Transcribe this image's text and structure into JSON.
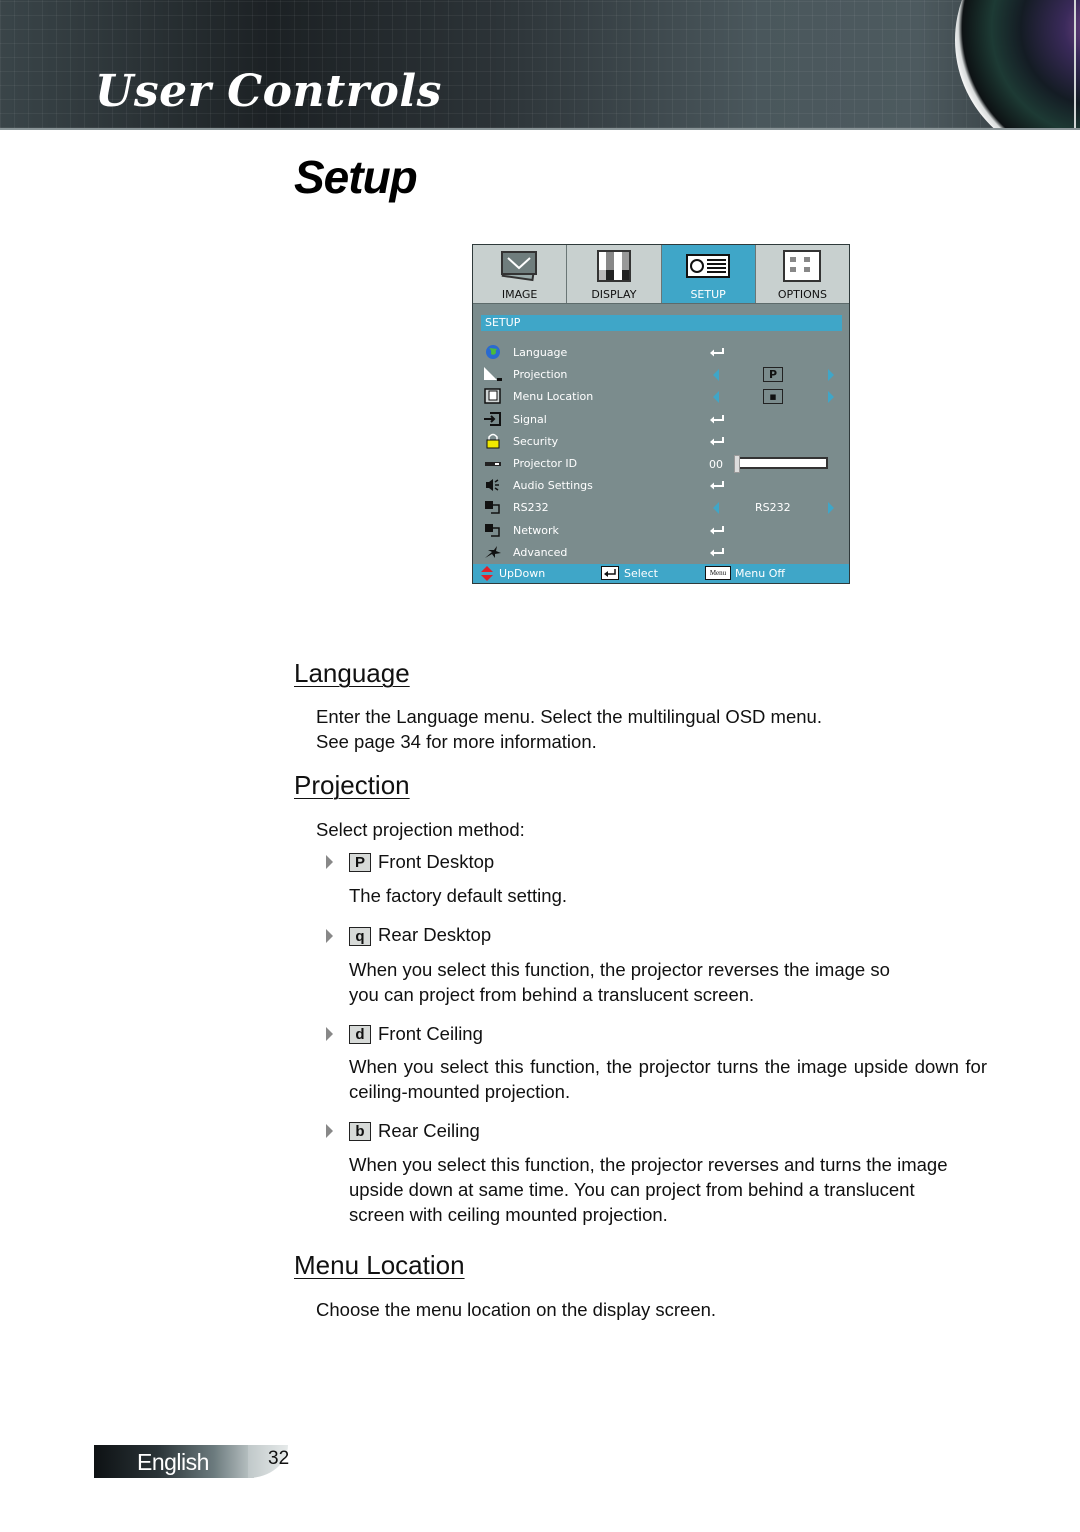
{
  "header": {
    "section_title": "User Controls"
  },
  "page_title": "Setup",
  "osd_menu": {
    "tabs": [
      {
        "label": "IMAGE",
        "icon": "image-icon",
        "active": false
      },
      {
        "label": "DISPLAY",
        "icon": "display-icon",
        "active": false
      },
      {
        "label": "SETUP",
        "icon": "projector-icon",
        "active": true
      },
      {
        "label": "OPTIONS",
        "icon": "options-icon",
        "active": false
      }
    ],
    "section_label": "SETUP",
    "items": [
      {
        "label": "Language",
        "icon": "globe-icon",
        "control": "enter"
      },
      {
        "label": "Projection",
        "icon": "projection-icon",
        "control": "arrows",
        "value": "P"
      },
      {
        "label": "Menu Location",
        "icon": "menu-location-icon",
        "control": "arrows",
        "value": "▪"
      },
      {
        "label": "Signal",
        "icon": "signal-icon",
        "control": "enter"
      },
      {
        "label": "Security",
        "icon": "lock-icon",
        "control": "enter"
      },
      {
        "label": "Projector ID",
        "icon": "projector-id-icon",
        "control": "slider",
        "value": "00",
        "slider_fraction": 0
      },
      {
        "label": "Audio Settings",
        "icon": "speaker-icon",
        "control": "enter"
      },
      {
        "label": "RS232",
        "icon": "rs232-icon",
        "control": "arrows",
        "value": "RS232"
      },
      {
        "label": "Network",
        "icon": "network-icon",
        "control": "enter"
      },
      {
        "label": "Advanced",
        "icon": "advanced-icon",
        "control": "enter"
      }
    ],
    "footer": {
      "updown": "UpDown",
      "select": "Select",
      "menu_key": "Menu",
      "menu_off": "Menu Off"
    },
    "colors": {
      "accent": "#3fa6c8",
      "body": "#7b8c8d",
      "tabs": "#c8d0cf"
    }
  },
  "sections": {
    "language": {
      "heading": "Language",
      "text_line1": "Enter the Language menu. Select the multilingual OSD menu.",
      "text_line2": "See page 34 for more information."
    },
    "projection": {
      "heading": "Projection",
      "intro": "Select projection method:",
      "options": [
        {
          "icon_glyph": "P",
          "label": "Front Desktop",
          "desc": [
            "The factory default setting."
          ]
        },
        {
          "icon_glyph": "q",
          "label": "Rear Desktop",
          "desc": [
            "When you select this function, the projector reverses the image so",
            "you can project from behind a translucent screen."
          ]
        },
        {
          "icon_glyph": "d",
          "label": "Front Ceiling",
          "desc": [
            "When you select this function, the projector turns the image upside down for ceiling-mounted projection."
          ]
        },
        {
          "icon_glyph": "b",
          "label": "Rear Ceiling",
          "desc": [
            "When you select this function, the projector reverses and turns the image upside down at same time. You can project from behind a translucent screen with ceiling mounted projection."
          ]
        }
      ]
    },
    "menu_location": {
      "heading": "Menu Location",
      "text": "Choose the menu location on the display screen."
    }
  },
  "footer": {
    "language": "English",
    "page_number": "32"
  }
}
